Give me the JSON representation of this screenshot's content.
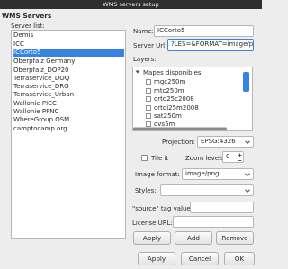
{
  "window": {
    "title": "WMS servers setup"
  },
  "section_title": "WMS Servers",
  "server_list": {
    "label": "Server list:",
    "items": [
      "Demis",
      "ICC",
      "ICCorto5",
      "Oberpfalz Germany",
      "Oberpfalz_DOP20",
      "Terraservice_DOQ",
      "Terraservice_DRG",
      "Terraservice_Urban",
      "Wallonie PICC",
      "Wallonie PPNC",
      "WhereGroup OSM",
      "camptocamp.org"
    ],
    "selected_index": 2
  },
  "form": {
    "name_label": "Name:",
    "name_value": "ICCorto5",
    "url_label": "Server Url:",
    "url_value": "?LES=&FORMAT=image/png",
    "layers_label": "Layers:",
    "layers_root": "Mapes disponibles",
    "layers": [
      "mgc250m",
      "mtc250m",
      "orto25c2008",
      "ortoi25m2008",
      "sat250m",
      "ovs5m"
    ],
    "projection_label": "Projection:",
    "projection_value": "EPSG:4326",
    "tile_label": "Tile it",
    "zoom_label": "Zoom levels",
    "zoom_value": "0",
    "format_label": "Image format:",
    "format_value": "image/png",
    "styles_label": "Styles:",
    "styles_value": "",
    "source_tag_label": "\"source\" tag value:",
    "source_tag_value": "",
    "license_label": "License URL:",
    "license_value": ""
  },
  "buttons": {
    "apply_row": "Apply",
    "add": "Add",
    "remove": "Remove",
    "apply": "Apply",
    "cancel": "Cancel",
    "ok": "OK"
  },
  "icons": {
    "expand": "triangle-down-icon",
    "combo": "chevron-down-icon",
    "spin_up": "plus-icon",
    "spin_down": "minus-icon"
  },
  "colors": {
    "selection": "#3584e4",
    "titlebar": "#2f2f2f",
    "background": "#ededed"
  }
}
